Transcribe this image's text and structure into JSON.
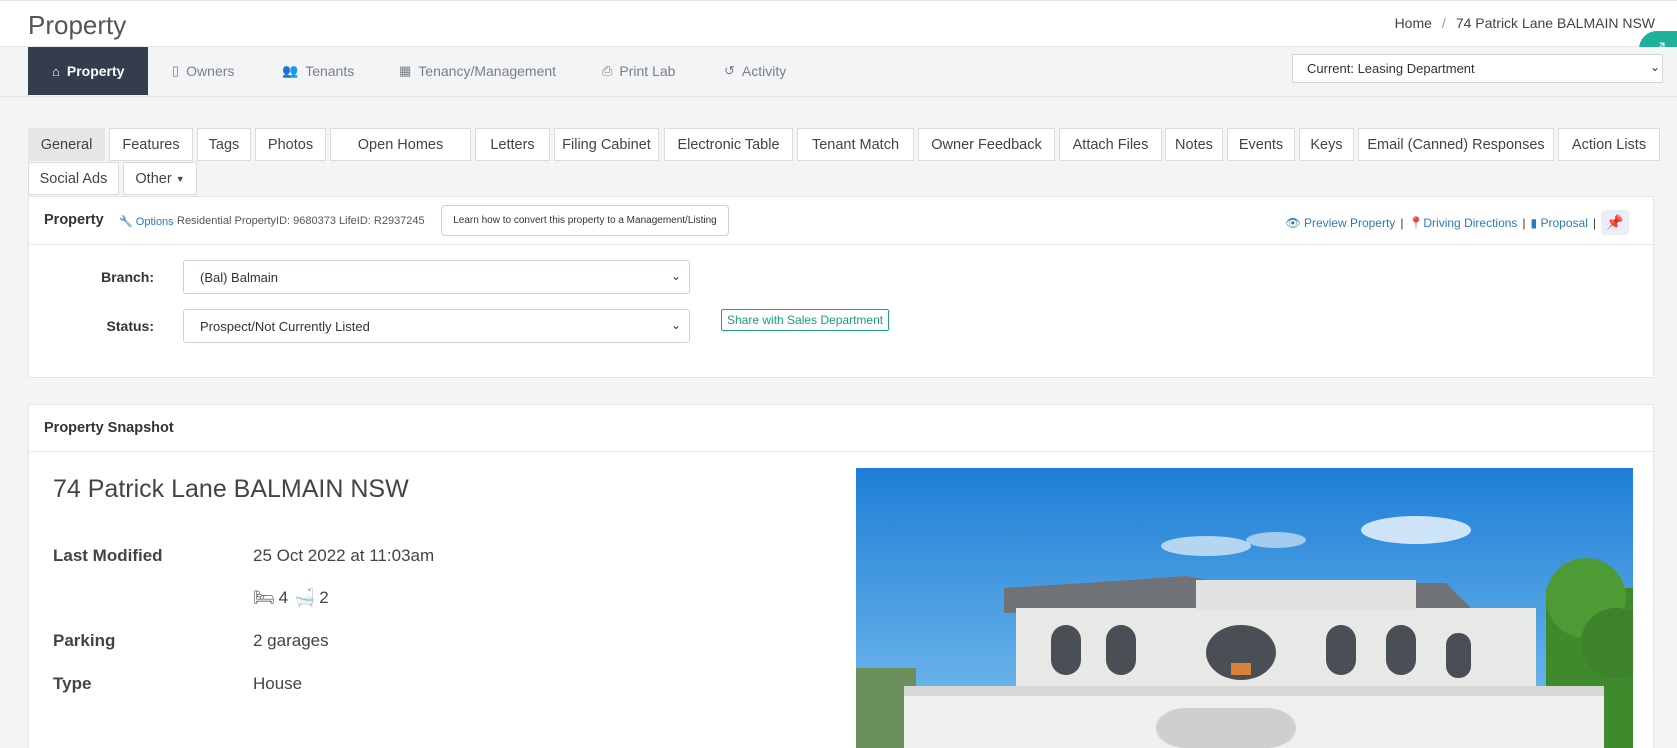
{
  "header": {
    "title": "Property",
    "breadcrumbs": [
      "Home",
      "74 Patrick Lane BALMAIN NSW"
    ]
  },
  "nav": {
    "items": [
      {
        "label": "Property",
        "icon": "home-icon"
      },
      {
        "label": "Owners",
        "icon": "file-icon"
      },
      {
        "label": "Tenants",
        "icon": "users-icon"
      },
      {
        "label": "Tenancy/Management",
        "icon": "calculator-icon"
      },
      {
        "label": "Print Lab",
        "icon": "print-icon"
      },
      {
        "label": "Activity",
        "icon": "history-icon"
      }
    ],
    "department": "Current: Leasing Department"
  },
  "tabs": [
    "General",
    "Features",
    "Tags",
    "Photos",
    "Open Homes",
    "Letters",
    "Filing Cabinet",
    "Electronic Table",
    "Tenant Match",
    "Owner Feedback",
    "Attach Files",
    "Notes",
    "Events",
    "Keys",
    "Email (Canned) Responses",
    "Action Lists",
    "Social Ads",
    "Other"
  ],
  "property_panel": {
    "title": "Property",
    "options": "Options",
    "meta": "Residential PropertyID: 9680373 LifeID: R2937245",
    "learn_button": "Learn how to convert this property to a Management/Listing",
    "links": [
      "Preview Property",
      "Driving Directions",
      "Proposal"
    ],
    "branch_label": "Branch:",
    "branch_value": "(Bal) Balmain",
    "status_label": "Status:",
    "status_value": "Prospect/Not Currently Listed",
    "share_button": "Share with Sales Department"
  },
  "snapshot": {
    "title": "Property Snapshot",
    "address": "74 Patrick Lane BALMAIN NSW",
    "last_modified_label": "Last Modified",
    "last_modified_value": "25 Oct 2022 at 11:03am",
    "bedrooms": "4",
    "bathrooms": "2",
    "parking_label": "Parking",
    "parking_value": "2 garages",
    "type_label": "Type",
    "type_value": "House"
  },
  "colors": {
    "active_nav": "#343d4b",
    "accent_green": "#1fb19a",
    "link_blue": "#2a7bbd"
  }
}
